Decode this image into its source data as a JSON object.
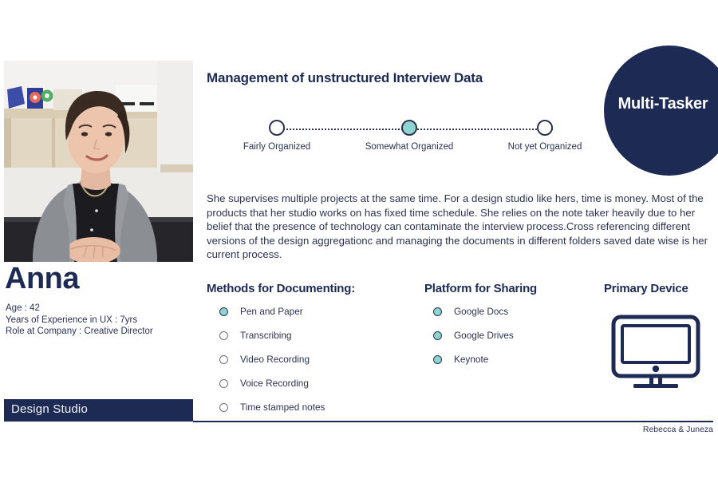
{
  "persona": {
    "name": "Anna",
    "facts": [
      "Age : 42",
      "Years of Experience in UX : 7yrs",
      "Role at Company : Creative Director"
    ],
    "company_bar": "Design Studio",
    "badge_label": "Multi-Tasker",
    "photo_alt": "persona-portrait"
  },
  "headline": "Management of unstructured Interview Data",
  "slider": {
    "options": [
      {
        "label": "Fairly Organized",
        "selected": false
      },
      {
        "label": "Somewhat Organized",
        "selected": true
      },
      {
        "label": "Not yet Organized",
        "selected": false
      }
    ]
  },
  "bio": "She supervises multiple projects at the same time. For a design studio like hers, time is money. Most of the products that her studio works on has fixed time schedule. She relies on the note taker heavily due to her belief that the presence of technology can contaminate the interview process.Cross referencing different versions of the design aggregationc and managing the documents in different folders saved date wise is her current process.",
  "columns": {
    "methods": {
      "heading": "Methods for Documenting:",
      "items": [
        {
          "label": "Pen and Paper",
          "selected": true
        },
        {
          "label": "Transcribing",
          "selected": false
        },
        {
          "label": "Video Recording",
          "selected": false
        },
        {
          "label": "Voice Recording",
          "selected": false
        },
        {
          "label": "Time stamped notes",
          "selected": false
        }
      ]
    },
    "platform": {
      "heading": "Platform for Sharing",
      "items": [
        {
          "label": "Google Docs",
          "selected": true
        },
        {
          "label": "Google Drives",
          "selected": true
        },
        {
          "label": "Keynote",
          "selected": true
        }
      ]
    },
    "device": {
      "heading": "Primary Device",
      "icon": "desktop-monitor-icon"
    }
  },
  "footer": {
    "credit": "Rebecca & Juneza"
  },
  "colors": {
    "navy": "#1d2a54",
    "teal": "#8fd3d3",
    "text": "#2b3350",
    "background": "#ffffff"
  }
}
